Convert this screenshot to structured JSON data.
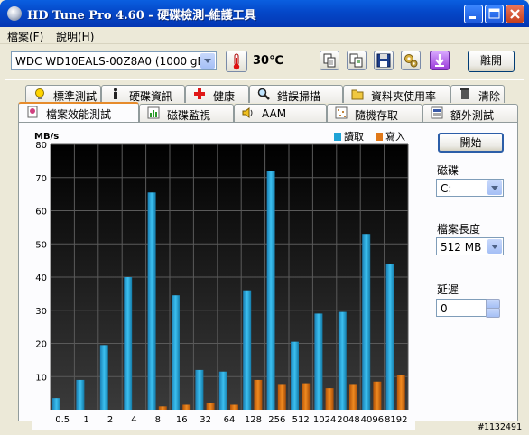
{
  "window": {
    "title": "HD Tune Pro 4.60 - 硬碟檢測-維護工具"
  },
  "menu": [
    {
      "label": "檔案(F)"
    },
    {
      "label": "說明(H)"
    }
  ],
  "toolbar": {
    "drive_select": "WDC WD10EALS-00Z8A0 (1000 gB)",
    "temperature": "30℃",
    "exit_label": "離開"
  },
  "tabs_row1": [
    {
      "label": "標準測試",
      "icon": "bulb-icon"
    },
    {
      "label": "硬碟資訊",
      "icon": "info-icon"
    },
    {
      "label": "健康",
      "icon": "health-cross-icon"
    },
    {
      "label": "錯誤掃描",
      "icon": "magnifier-icon"
    },
    {
      "label": "資料夾使用率",
      "icon": "folder-icon"
    },
    {
      "label": "清除",
      "icon": "trash-icon"
    }
  ],
  "tabs_row2": [
    {
      "label": "檔案效能測試",
      "icon": "file-benchmark-icon",
      "active": true
    },
    {
      "label": "磁碟監視",
      "icon": "monitor-bars-icon"
    },
    {
      "label": "AAM",
      "icon": "speaker-icon"
    },
    {
      "label": "隨機存取",
      "icon": "random-access-icon"
    },
    {
      "label": "額外測試",
      "icon": "extra-tests-icon"
    }
  ],
  "controls": {
    "start_label": "開始",
    "disk_label": "磁碟",
    "disk_value": "C:",
    "file_length_label": "檔案長度",
    "file_length_value": "512 MB",
    "delay_label": "延遲",
    "delay_value": "0"
  },
  "chart_data": {
    "type": "bar",
    "ylabel": "MB/s",
    "ylim": [
      0,
      80
    ],
    "yticks": [
      10,
      20,
      30,
      40,
      50,
      60,
      70,
      80
    ],
    "categories": [
      "0.5",
      "1",
      "2",
      "4",
      "8",
      "16",
      "32",
      "64",
      "128",
      "256",
      "512",
      "1024",
      "2048",
      "4096",
      "8192"
    ],
    "series": [
      {
        "name": "讀取",
        "color": "#1fa3d6",
        "values": [
          3.5,
          9,
          19.5,
          40,
          65.5,
          34.5,
          12,
          11.5,
          36,
          72,
          20.5,
          29,
          29.5,
          53,
          44
        ]
      },
      {
        "name": "寫入",
        "color": "#e07818",
        "values": [
          0,
          0,
          0,
          0,
          1,
          1.5,
          2,
          1.5,
          9,
          7.5,
          8,
          6.5,
          7.5,
          8.5,
          10.5
        ]
      }
    ],
    "legend_position": "top-right",
    "grid": true
  },
  "watermark": "#1132491"
}
